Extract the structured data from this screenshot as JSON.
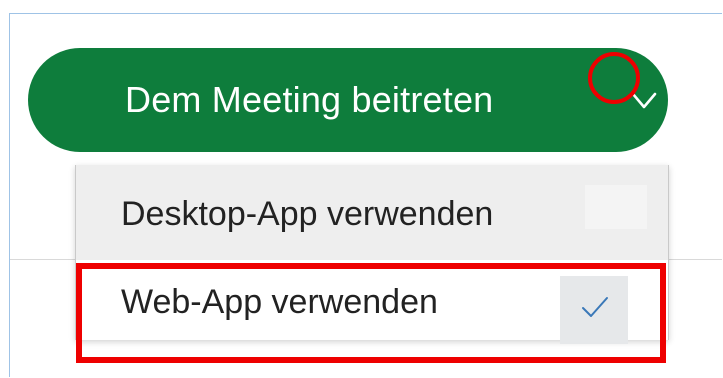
{
  "join_button": {
    "label": "Dem Meeting beitreten",
    "color": "#0e7d3c",
    "chevron_icon": "chevron-down-icon"
  },
  "dropdown": {
    "options": [
      {
        "label": "Desktop-App verwenden",
        "selected": false
      },
      {
        "label": "Web-App verwenden",
        "selected": true,
        "indicator_icon": "checkmark-icon"
      }
    ]
  },
  "annotations": {
    "highlight_color": "#ee0000",
    "highlights": [
      "chevron-down-icon",
      "option-web-app"
    ]
  }
}
